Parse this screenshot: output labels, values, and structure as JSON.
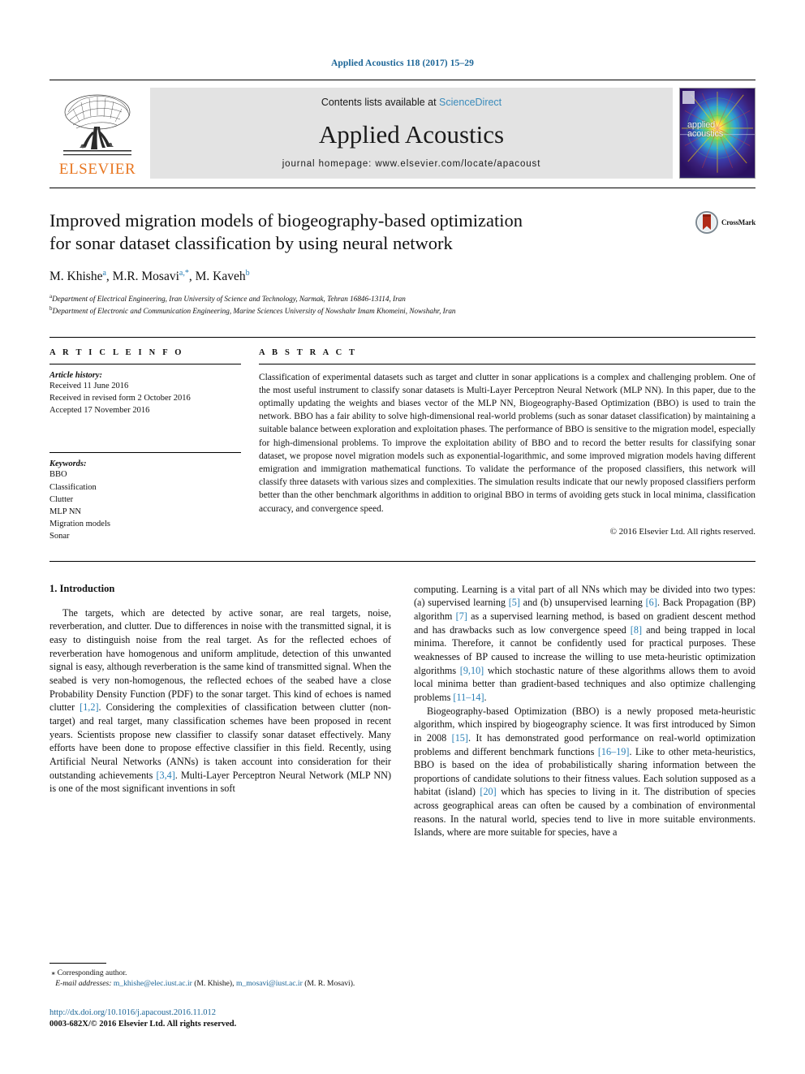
{
  "running_head": "Applied Acoustics 118 (2017) 15–29",
  "masthead": {
    "publisher_name": "ELSEVIER",
    "contents_prefix": "Contents lists available at ",
    "contents_link": "ScienceDirect",
    "journal_title": "Applied Acoustics",
    "homepage": "journal homepage: www.elsevier.com/locate/apacoust",
    "cover_label_line1": "applied",
    "cover_label_line2": "acoustics"
  },
  "article": {
    "title_line1": "Improved migration models of biogeography-based optimization",
    "title_line2": "for sonar dataset classification by using neural network",
    "authors": "M. Khishe a, M.R. Mosavi a,*, M. Kaveh b",
    "author_list": [
      {
        "name": "M. Khishe",
        "marks": "a"
      },
      {
        "name": "M.R. Mosavi",
        "marks": "a,*"
      },
      {
        "name": "M. Kaveh",
        "marks": "b"
      }
    ],
    "affiliations": [
      {
        "mark": "a",
        "text": "Department of Electrical Engineering, Iran University of Science and Technology, Narmak, Tehran 16846-13114, Iran"
      },
      {
        "mark": "b",
        "text": "Department of Electronic and Communication Engineering, Marine Sciences University of Nowshahr Imam Khomeini, Nowshahr, Iran"
      }
    ],
    "crossmark_label": "CrossMark"
  },
  "info": {
    "heading": "A R T I C L E   I N F O",
    "history_label": "Article history:",
    "history": [
      "Received 11 June 2016",
      "Received in revised form 2 October 2016",
      "Accepted 17 November 2016"
    ],
    "keywords_label": "Keywords:",
    "keywords": [
      "BBO",
      "Classification",
      "Clutter",
      "MLP NN",
      "Migration models",
      "Sonar"
    ]
  },
  "abstract": {
    "heading": "A B S T R A C T",
    "text": "Classification of experimental datasets such as target and clutter in sonar applications is a complex and challenging problem. One of the most useful instrument to classify sonar datasets is Multi-Layer Perceptron Neural Network (MLP NN). In this paper, due to the optimally updating the weights and biases vector of the MLP NN, Biogeography-Based Optimization (BBO) is used to train the network. BBO has a fair ability to solve high-dimensional real-world problems (such as sonar dataset classification) by maintaining a suitable balance between exploration and exploitation phases. The performance of BBO is sensitive to the migration model, especially for high-dimensional problems. To improve the exploitation ability of BBO and to record the better results for classifying sonar dataset, we propose novel migration models such as exponential-logarithmic, and some improved migration models having different emigration and immigration mathematical functions. To validate the performance of the proposed classifiers, this network will classify three datasets with various sizes and complexities. The simulation results indicate that our newly proposed classifiers perform better than the other benchmark algorithms in addition to original BBO in terms of avoiding gets stuck in local minima, classification accuracy, and convergence speed.",
    "copyright": "© 2016 Elsevier Ltd. All rights reserved."
  },
  "body": {
    "section_heading": "1. Introduction",
    "left_para_1_a": "The targets, which are detected by active sonar, are real targets, noise, reverberation, and clutter. Due to differences in noise with the transmitted signal, it is easy to distinguish noise from the real target. As for the reflected echoes of reverberation have homogenous and uniform amplitude, detection of this unwanted signal is easy, although reverberation is the same kind of transmitted signal. When the seabed is very non-homogenous, the reflected echoes of the seabed have a close Probability Density Function (PDF) to the sonar target. This kind of echoes is named clutter ",
    "ref_1_2": "[1,2]",
    "left_para_1_b": ". Considering the complexities of classification between clutter (non-target) and real target, many classification schemes have been proposed in recent years. Scientists propose new classifier to classify sonar dataset effectively. Many efforts have been done to propose effective classifier in this field. Recently, using Artificial Neural Networks (ANNs) is taken account into consideration for their outstanding achievements ",
    "ref_3_4": "[3,4]",
    "left_para_1_c": ". Multi-Layer Perceptron Neural Network (MLP NN) is one of the most significant inventions in soft",
    "right_para_1_a": "computing. Learning is a vital part of all NNs which may be divided into two types: (a) supervised learning ",
    "ref_5": "[5]",
    "right_para_1_b": " and (b) unsupervised learning ",
    "ref_6": "[6]",
    "right_para_1_c": ". Back Propagation (BP) algorithm ",
    "ref_7": "[7]",
    "right_para_1_d": " as a supervised learning method, is based on gradient descent method and has drawbacks such as low convergence speed ",
    "ref_8": "[8]",
    "right_para_1_e": " and being trapped in local minima. Therefore, it cannot be confidently used for practical purposes. These weaknesses of BP caused to increase the willing to use meta-heuristic optimization algorithms ",
    "ref_9_10": "[9,10]",
    "right_para_1_f": " which stochastic nature of these algorithms allows them to avoid local minima better than gradient-based techniques and also optimize challenging problems ",
    "ref_11_14": "[11–14]",
    "right_para_1_g": ".",
    "right_para_2_a": "Biogeography-based Optimization (BBO) is a newly proposed meta-heuristic algorithm, which inspired by biogeography science. It was first introduced by Simon in 2008 ",
    "ref_15": "[15]",
    "right_para_2_b": ". It has demonstrated good performance on real-world optimization problems and different benchmark functions ",
    "ref_16_19": "[16–19]",
    "right_para_2_c": ". Like to other meta-heuristics, BBO is based on the idea of probabilistically sharing information between the proportions of candidate solutions to their fitness values. Each solution supposed as a habitat (island) ",
    "ref_20": "[20]",
    "right_para_2_d": " which has species to living in it. The distribution of species across geographical areas can often be caused by a combination of environmental reasons. In the natural world, species tend to live in more suitable environments. Islands, where are more suitable for species, have a"
  },
  "footer": {
    "corresponding_marker": "⁎",
    "corresponding_label": "Corresponding author.",
    "email_label": "E-mail addresses:",
    "email_1": "m_khishe@elec.iust.ac.ir",
    "email_1_owner": "(M. Khishe),",
    "email_2": "m_mosavi@iust.ac.ir",
    "email_2_owner": "(M.",
    "email_2_owner_cont": "R. Mosavi).",
    "doi": "http://dx.doi.org/10.1016/j.apacoust.2016.11.012",
    "issn": "0003-682X/© 2016 Elsevier Ltd. All rights reserved."
  },
  "colors": {
    "link_blue": "#1a6496",
    "ref_blue": "#2a7fb5",
    "elsevier_orange": "#E87722",
    "masthead_gray": "#e3e3e3"
  }
}
